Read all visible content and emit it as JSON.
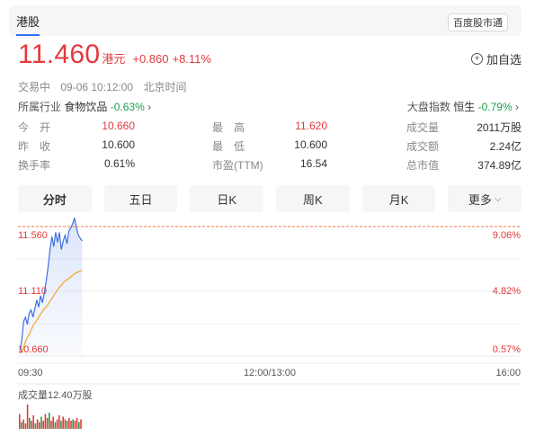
{
  "header": {
    "market_tab": "港股",
    "badge": "百度股市通"
  },
  "quote": {
    "price": "11.460",
    "unit": "港元",
    "change": "+0.860",
    "change_pct": "+8.11%",
    "add_watch_label": "加自选",
    "status": "交易中",
    "datetime": "09-06 10:12:00",
    "timezone": "北京时间"
  },
  "industry": {
    "label": "所属行业",
    "name": "食物饮品",
    "change": "-0.63%"
  },
  "index": {
    "label": "大盘指数",
    "name": "恒生",
    "change": "-0.79%"
  },
  "stats": [
    {
      "l1": "今　开",
      "v1": "10.660",
      "l2": "最　高",
      "v2": "11.620",
      "l3": "成交量",
      "v3": "2011万股"
    },
    {
      "l1": "昨　收",
      "v1": "10.600",
      "l2": "最　低",
      "v2": "10.600",
      "l3": "成交额",
      "v3": "2.24亿"
    },
    {
      "l1": "换手率",
      "v1": "0.61%",
      "l2": "市盈(TTM)",
      "v2": "16.54",
      "l3": "总市值",
      "v3": "374.89亿"
    }
  ],
  "tabs": [
    "分时",
    "五日",
    "日K",
    "周K",
    "月K",
    "更多"
  ],
  "chart_data": {
    "type": "line",
    "price_axis": {
      "top": "11.560",
      "mid": "11.110",
      "bottom": "10.660",
      "range": [
        10.66,
        11.56
      ]
    },
    "pct_axis": {
      "top": "9.06%",
      "mid": "4.82%",
      "bottom": "0.57%"
    },
    "time_ticks": [
      "09:30",
      "12:00/13:00",
      "16:00"
    ],
    "reference_price": 11.56,
    "series": [
      {
        "values": [
          10.7,
          10.76,
          10.9,
          10.93,
          10.88,
          10.96,
          10.98,
          10.93,
          10.99,
          11.05,
          11.0,
          11.08,
          11.03,
          11.1,
          11.18,
          11.28,
          11.4,
          11.49,
          11.42,
          11.52,
          11.45,
          11.52,
          11.4,
          11.46,
          11.5,
          11.44,
          11.53,
          11.55,
          11.58,
          11.62,
          11.55,
          11.5,
          11.48,
          11.46
        ]
      },
      {
        "values": [
          10.68,
          10.69,
          10.72,
          10.76,
          10.79,
          10.81,
          10.84,
          10.87,
          10.89,
          10.91,
          10.93,
          10.95,
          10.97,
          10.99,
          11.0,
          11.02,
          11.04,
          11.06,
          11.08,
          11.1,
          11.12,
          11.14,
          11.15,
          11.17,
          11.18,
          11.19,
          11.2,
          11.21,
          11.22,
          11.23,
          11.24,
          11.245,
          11.25,
          11.255
        ]
      }
    ],
    "volume_label": "成交量12.40万股",
    "volume": [
      {
        "v": 0.55,
        "up": true
      },
      {
        "v": 0.25,
        "up": false
      },
      {
        "v": 0.35,
        "up": true
      },
      {
        "v": 0.2,
        "up": true
      },
      {
        "v": 0.9,
        "up": true
      },
      {
        "v": 0.4,
        "up": false
      },
      {
        "v": 0.3,
        "up": true
      },
      {
        "v": 0.5,
        "up": true
      },
      {
        "v": 0.2,
        "up": false
      },
      {
        "v": 0.35,
        "up": true
      },
      {
        "v": 0.25,
        "up": true
      },
      {
        "v": 0.45,
        "up": false
      },
      {
        "v": 0.3,
        "up": true
      },
      {
        "v": 0.55,
        "up": true
      },
      {
        "v": 0.4,
        "up": true
      },
      {
        "v": 0.6,
        "up": false
      },
      {
        "v": 0.3,
        "up": true
      },
      {
        "v": 0.45,
        "up": true
      },
      {
        "v": 0.25,
        "up": false
      },
      {
        "v": 0.35,
        "up": true
      },
      {
        "v": 0.5,
        "up": true
      },
      {
        "v": 0.3,
        "up": false
      },
      {
        "v": 0.45,
        "up": true
      },
      {
        "v": 0.35,
        "up": true
      },
      {
        "v": 0.3,
        "up": false
      },
      {
        "v": 0.4,
        "up": true
      },
      {
        "v": 0.3,
        "up": true
      },
      {
        "v": 0.35,
        "up": false
      },
      {
        "v": 0.3,
        "up": true
      },
      {
        "v": 0.4,
        "up": true
      },
      {
        "v": 0.25,
        "up": false
      },
      {
        "v": 0.35,
        "up": true
      }
    ],
    "colors": {
      "price": "#3d6fe0",
      "avg": "#f5a623",
      "up": "#e4393c",
      "down": "#1aa34a",
      "ref": "#f07a4a"
    }
  }
}
